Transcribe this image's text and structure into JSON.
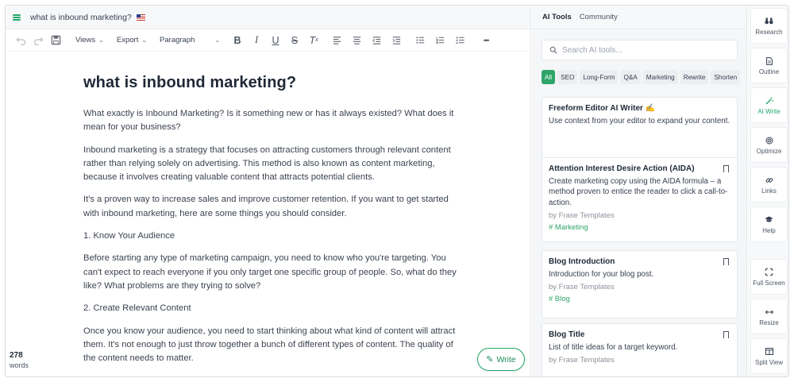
{
  "document": {
    "title": "what is inbound marketing?"
  },
  "toolbar": {
    "views_label": "Views",
    "export_label": "Export",
    "paragraph_label": "Paragraph",
    "more_label": "•••"
  },
  "editor": {
    "heading": "what is inbound marketing?",
    "paragraphs": [
      "What exactly is Inbound Marketing? Is it something new or has it always existed? What does it mean for your business?",
      "Inbound marketing is a strategy that focuses on attracting customers through relevant content rather than relying solely on advertising. This method is also known as content marketing, because it involves creating valuable content that attracts potential clients.",
      "It's a proven way to increase sales and improve customer retention. If you want to get started with inbound marketing, here are some things you should consider.",
      "1. Know Your Audience",
      "Before starting any type of marketing campaign, you need to know who you're targeting. You can't expect to reach everyone if you only target one specific group of people. So, what do they like? What problems are they trying to solve?",
      "2. Create Relevant Content",
      "Once you know your audience, you need to start thinking about what kind of content will attract them. It's not enough to just throw together a bunch of different types of content. The quality of the content needs to matter."
    ],
    "word_count": "278",
    "word_count_label": "words",
    "write_button": "Write"
  },
  "ai_panel": {
    "tabs": [
      "AI Tools",
      "Community"
    ],
    "search_placeholder": "Search AI tools...",
    "chips": [
      "All",
      "SEO",
      "Long-Form",
      "Q&A",
      "Marketing",
      "Rewrite",
      "Shorten"
    ],
    "cards": [
      {
        "title": "Freeform Editor AI Writer ✍️",
        "desc": "Use context from your editor to expand your content.",
        "by": "",
        "tag": ""
      },
      {
        "title": "Attention Interest Desire Action (AIDA)",
        "desc": "Create marketing copy using the AIDA formula – a method proven to entice the reader to click a call-to-action.",
        "by": "by Frase Templates",
        "tag": "# Marketing"
      },
      {
        "title": "Blog Introduction",
        "desc": "Introduction for your blog post.",
        "by": "by Frase Templates",
        "tag": "# Blog"
      },
      {
        "title": "Blog Title",
        "desc": "List of title ideas for a target keyword.",
        "by": "by Frase Templates",
        "tag": ""
      }
    ]
  },
  "rail": {
    "items": [
      {
        "label": "Research",
        "icon": "binoculars-icon"
      },
      {
        "label": "Outline",
        "icon": "document-icon"
      },
      {
        "label": "AI Write",
        "icon": "wand-icon"
      },
      {
        "label": "Optimize",
        "icon": "target-icon"
      },
      {
        "label": "Links",
        "icon": "link-icon"
      },
      {
        "label": "Help",
        "icon": "graduation-cap-icon"
      },
      {
        "label": "Full Screen",
        "icon": "expand-icon"
      },
      {
        "label": "Resize",
        "icon": "resize-arrows-icon"
      },
      {
        "label": "Split View",
        "icon": "split-view-icon"
      }
    ],
    "active": "AI Write"
  },
  "colors": {
    "accent": "#23a86b",
    "accent_chip": "#2fa56a"
  }
}
